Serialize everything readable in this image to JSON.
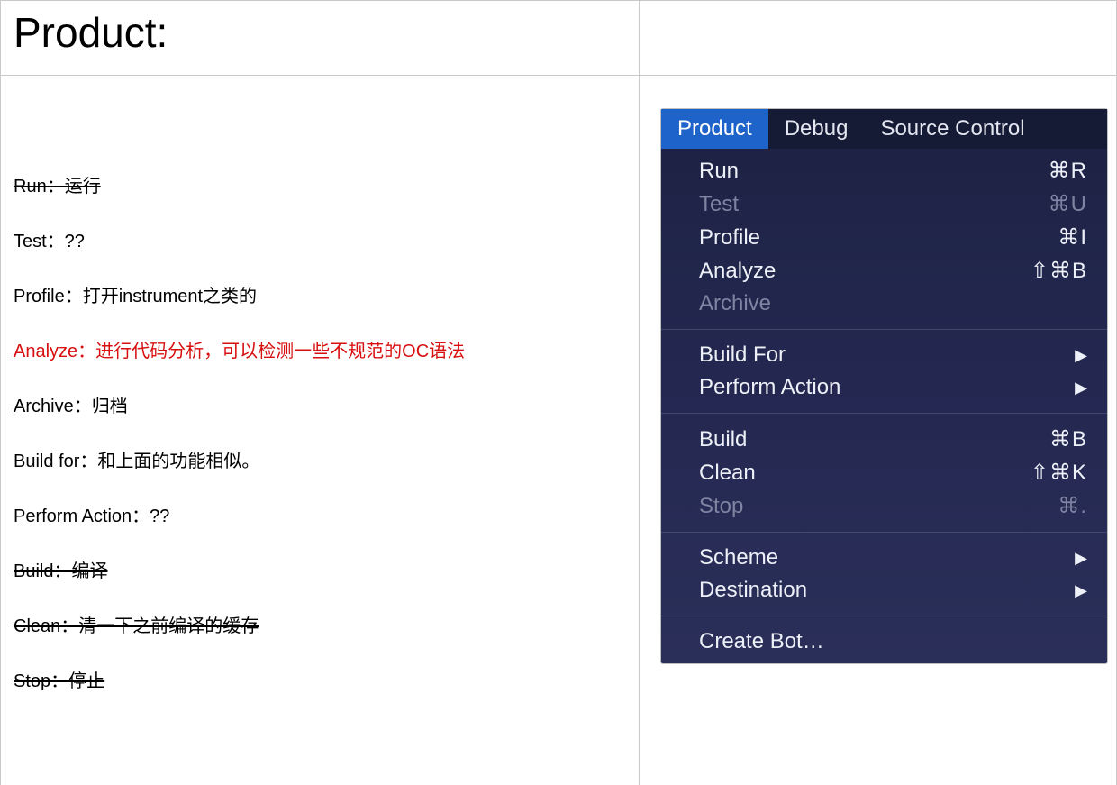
{
  "header": {
    "title": "Product:"
  },
  "notes": [
    {
      "text": "Run：运行",
      "strike": true,
      "red": false
    },
    {
      "text": "Test：??",
      "strike": false,
      "red": false
    },
    {
      "text": "Profile：打开instrument之类的",
      "strike": false,
      "red": false
    },
    {
      "text": "Analyze：进行代码分析，可以检测一些不规范的OC语法",
      "strike": false,
      "red": true
    },
    {
      "text": "Archive：归档",
      "strike": false,
      "red": false
    },
    {
      "text": "Build for：和上面的功能相似。",
      "strike": false,
      "red": false
    },
    {
      "text": "Perform Action：??",
      "strike": false,
      "red": false
    },
    {
      "text": "Build：编译",
      "strike": true,
      "red": false
    },
    {
      "text": "Clean：清一下之前编译的缓存",
      "strike": true,
      "red": false
    },
    {
      "text": "Stop：停止",
      "strike": true,
      "red": false
    }
  ],
  "menubar": {
    "items": [
      {
        "label": "Product",
        "active": true
      },
      {
        "label": "Debug",
        "active": false
      },
      {
        "label": "Source Control",
        "active": false
      }
    ]
  },
  "menu": {
    "groups": [
      [
        {
          "label": "Run",
          "shortcut": "⌘R",
          "disabled": false,
          "submenu": false
        },
        {
          "label": "Test",
          "shortcut": "⌘U",
          "disabled": true,
          "submenu": false
        },
        {
          "label": "Profile",
          "shortcut": "⌘I",
          "disabled": false,
          "submenu": false
        },
        {
          "label": "Analyze",
          "shortcut": "⇧⌘B",
          "disabled": false,
          "submenu": false
        },
        {
          "label": "Archive",
          "shortcut": "",
          "disabled": true,
          "submenu": false
        }
      ],
      [
        {
          "label": "Build For",
          "shortcut": "",
          "disabled": false,
          "submenu": true
        },
        {
          "label": "Perform Action",
          "shortcut": "",
          "disabled": false,
          "submenu": true
        }
      ],
      [
        {
          "label": "Build",
          "shortcut": "⌘B",
          "disabled": false,
          "submenu": false
        },
        {
          "label": "Clean",
          "shortcut": "⇧⌘K",
          "disabled": false,
          "submenu": false
        },
        {
          "label": "Stop",
          "shortcut": "⌘.",
          "disabled": true,
          "submenu": false
        }
      ],
      [
        {
          "label": "Scheme",
          "shortcut": "",
          "disabled": false,
          "submenu": true
        },
        {
          "label": "Destination",
          "shortcut": "",
          "disabled": false,
          "submenu": true
        }
      ],
      [
        {
          "label": "Create Bot…",
          "shortcut": "",
          "disabled": false,
          "submenu": false
        }
      ]
    ]
  }
}
